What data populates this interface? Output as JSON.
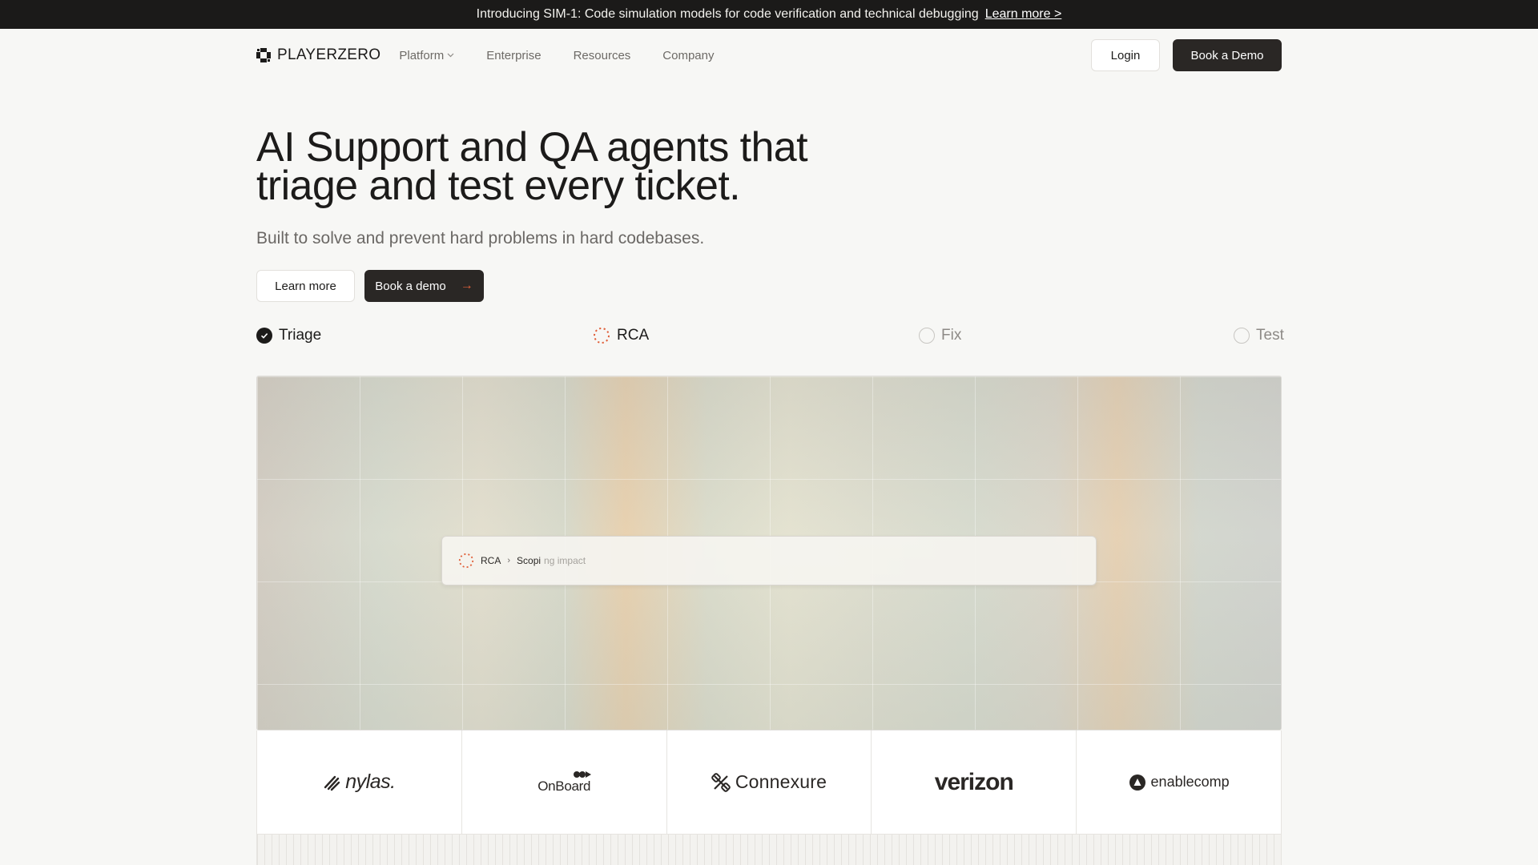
{
  "announcement": {
    "text": "Introducing SIM-1: Code simulation models for code verification and technical debugging",
    "link": "Learn more >"
  },
  "nav": {
    "brand": "PLAYERZERO",
    "links": [
      {
        "label": "Platform",
        "has_dropdown": true
      },
      {
        "label": "Enterprise"
      },
      {
        "label": "Resources"
      },
      {
        "label": "Company"
      }
    ],
    "login": "Login",
    "book_demo": "Book a Demo"
  },
  "hero": {
    "title_line1": "AI Support and QA agents that",
    "title_line2": "triage and test every ticket.",
    "subtitle": "Built to solve and prevent hard problems in hard codebases.",
    "learn_more": "Learn more",
    "book_demo": "Book a demo"
  },
  "steps": [
    {
      "label": "Triage",
      "state": "done"
    },
    {
      "label": "RCA",
      "state": "active"
    },
    {
      "label": "Fix",
      "state": "pending"
    },
    {
      "label": "Test",
      "state": "pending"
    }
  ],
  "status_card": {
    "step": "RCA",
    "separator": "›",
    "activity_done": "Scopi",
    "activity_rest": "ng impact"
  },
  "logos": [
    {
      "name": "nylas",
      "text": "nylas."
    },
    {
      "name": "onboard",
      "text": "OnBoard"
    },
    {
      "name": "connexure",
      "text": "Connexure"
    },
    {
      "name": "verizon",
      "text": "verizon"
    },
    {
      "name": "enablecomp",
      "text": "enablecomp"
    }
  ],
  "colors": {
    "accent": "#e0603a",
    "dark": "#2a2725",
    "background": "#f7f7f5"
  }
}
